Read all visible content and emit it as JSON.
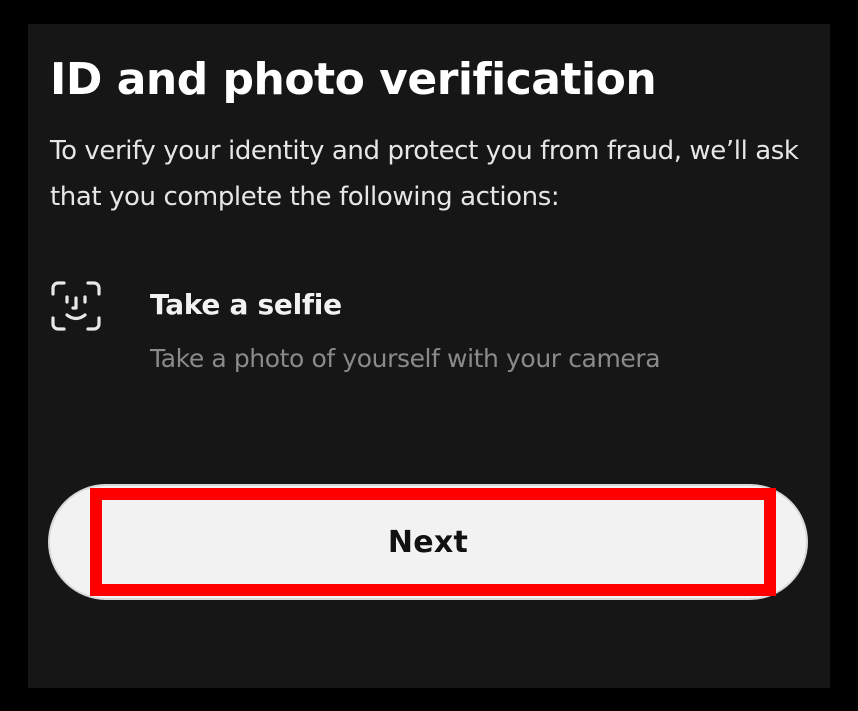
{
  "screen": {
    "title": "ID and photo verification",
    "subtitle": "To verify your identity and protect you from fraud, we’ll ask that you complete the following actions:"
  },
  "actions": [
    {
      "icon": "face-scan-icon",
      "title": "Take a selfie",
      "description": "Take a photo of yourself with your camera"
    }
  ],
  "footer": {
    "next_label": "Next",
    "highlight_color": "#ff0000"
  },
  "colors": {
    "background": "#161616",
    "button": "#f2f2f2",
    "text_primary": "#ffffff",
    "text_secondary": "#8a8a8a"
  }
}
